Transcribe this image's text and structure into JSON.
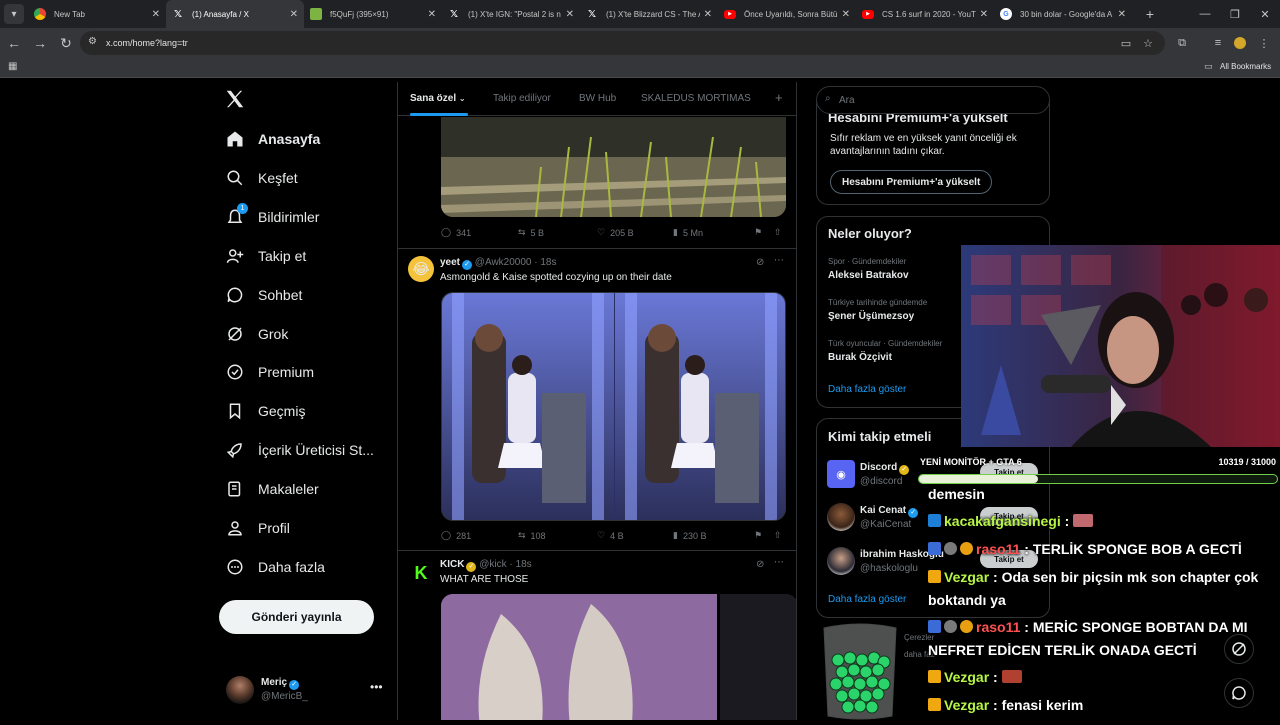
{
  "browser": {
    "tabs": [
      {
        "title": "New Tab",
        "favicon": "chrome-icon",
        "color": "#8ab4f8"
      },
      {
        "title": "(1) Anasayfa / X",
        "favicon": "x-logo-icon",
        "color": "#ffffff",
        "active": true
      },
      {
        "title": "f5QuFj (395×91)",
        "favicon": "image-icon",
        "color": "#7cb342"
      },
      {
        "title": "(1) X'te IGN: \"Postal 2 is n",
        "favicon": "x-logo-icon",
        "color": "#ffffff"
      },
      {
        "title": "(1) X'te Blizzard CS - The A",
        "favicon": "x-logo-icon",
        "color": "#ffffff"
      },
      {
        "title": "Önce Uyarıldı, Sonra Bütü",
        "favicon": "youtube-icon",
        "color": "#ff0000"
      },
      {
        "title": "CS 1.6 surf in 2020 - YouT",
        "favicon": "youtube-icon",
        "color": "#ff0000"
      },
      {
        "title": "30 bin dolar - Google'da A",
        "favicon": "google-icon",
        "color": "#4285f4"
      }
    ],
    "url": "x.com/home?lang=tr",
    "bookmarks_label": "All Bookmarks"
  },
  "leftnav": {
    "items": [
      {
        "label": "Anasayfa",
        "icon": "home-icon"
      },
      {
        "label": "Keşfet",
        "icon": "search-icon"
      },
      {
        "label": "Bildirimler",
        "icon": "bell-icon",
        "badge": "1"
      },
      {
        "label": "Takip et",
        "icon": "follow-icon"
      },
      {
        "label": "Sohbet",
        "icon": "chat-icon"
      },
      {
        "label": "Grok",
        "icon": "grok-icon"
      },
      {
        "label": "Premium",
        "icon": "premium-icon"
      },
      {
        "label": "Geçmiş",
        "icon": "bookmark-icon"
      },
      {
        "label": "İçerik Üreticisi St...",
        "icon": "rocket-icon"
      },
      {
        "label": "Makaleler",
        "icon": "articles-icon"
      },
      {
        "label": "Profil",
        "icon": "profile-icon"
      },
      {
        "label": "Daha fazla",
        "icon": "more-icon"
      }
    ],
    "post_button": "Gönderi yayınla",
    "profile": {
      "name": "Meriç",
      "handle": "@MericB_"
    }
  },
  "feed": {
    "tabs": [
      "Sana özel",
      "Takip ediliyor",
      "BW Hub",
      "SKALEDUS MORTIMAS"
    ],
    "add_tab": "+",
    "tweets": [
      {
        "stats": {
          "replies": "341",
          "retweets": "5 B",
          "likes": "205 B",
          "views": "5 Mn"
        }
      },
      {
        "name": "yeet",
        "handle": "@Awk20000",
        "time": "18s",
        "text": "Asmongold & Kaise spotted cozying up on their date",
        "stats": {
          "replies": "281",
          "retweets": "108",
          "likes": "4 B",
          "views": "230 B"
        }
      },
      {
        "name": "KICK",
        "handle": "@kick",
        "time": "18s",
        "text": "WHAT ARE THOSE"
      }
    ]
  },
  "rightcol": {
    "search_placeholder": "Ara",
    "premium": {
      "title": "Hesabını Premium+'a yükselt",
      "desc": "Sıfır reklam ve en yüksek yanıt önceliği ek avantajlarının tadını çıkar.",
      "button": "Hesabını Premium+'a yükselt"
    },
    "trends": {
      "title": "Neler oluyor?",
      "items": [
        {
          "meta": "Spor · Gündemdekiler",
          "name": "Aleksei Batrakov"
        },
        {
          "meta": "Türkiye tarihinde gündemde",
          "name": "Şener Üşümezsoy"
        },
        {
          "meta": "Türk oyuncular · Gündemdekiler",
          "name": "Burak Özçivit"
        }
      ],
      "more": "Daha fazla göster"
    },
    "who_to_follow": {
      "title": "Kimi takip etmeli",
      "items": [
        {
          "name": "Discord",
          "handle": "@discord",
          "button": "Takip et"
        },
        {
          "name": "Kai Cenat",
          "handle": "@KaiCenat",
          "button": "Takip et"
        },
        {
          "name": "ibrahim Haskoğlu",
          "handle": "@haskologlu",
          "button": "Takip et"
        }
      ],
      "more": "Daha fazla göster"
    },
    "footer_fragments": [
      "Çerezler",
      "daha faz"
    ]
  },
  "overlay": {
    "goal": {
      "label": "YENİ MONİTÖR + GTA 6",
      "count": "10319 / 31000",
      "progress": 0.333
    },
    "chat": [
      {
        "text": "demesin"
      },
      {
        "user": "kacakafgansinegi",
        "sep": " : ",
        "msg": "",
        "color": "#b6f545"
      },
      {
        "user": "raso11",
        "sep": " : ",
        "msg": "TERLİK SPONGE BOB A GECTİ",
        "color": "#ff5151"
      },
      {
        "user": "Vezgar",
        "sep": " : ",
        "msg": "Oda sen bir piçsin mk son chapter çok boktandı ya",
        "color": "#b6f545"
      },
      {
        "user": "raso11",
        "sep": " : ",
        "msg": "MERİC SPONGE BOBTAN DA MI NEFRET EDİCEN TERLİK ONADA GECTİ",
        "color": "#ff5151"
      },
      {
        "user": "Vezgar",
        "sep": " : ",
        "msg": "",
        "color": "#b6f545"
      },
      {
        "user": "Vezgar",
        "sep": " : ",
        "msg": "fenasi kerim",
        "color": "#b6f545"
      }
    ]
  }
}
